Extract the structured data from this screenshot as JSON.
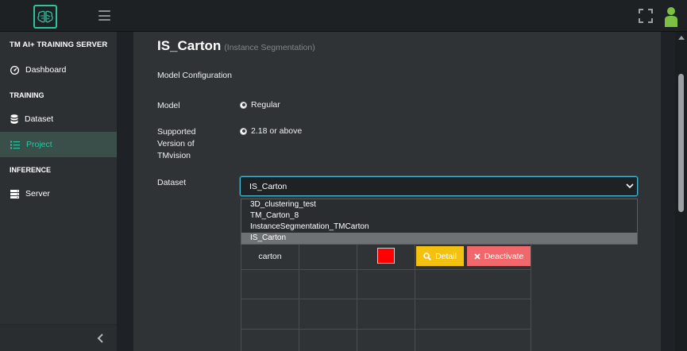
{
  "header": {
    "logo_icon": "brain-icon",
    "menu_icon": "hamburger-icon",
    "fullscreen_icon": "fullscreen-icon",
    "user_icon": "user-icon",
    "accent_color": "#2ec4a0"
  },
  "sidebar": {
    "brand": "TM AI+ TRAINING SERVER",
    "items": [
      {
        "type": "item",
        "label": "Dashboard",
        "icon": "gauge-icon"
      },
      {
        "type": "section",
        "label": "TRAINING"
      },
      {
        "type": "item",
        "label": "Dataset",
        "icon": "database-icon"
      },
      {
        "type": "item",
        "label": "Project",
        "icon": "list-icon",
        "active": true
      },
      {
        "type": "section",
        "label": "INFERENCE"
      },
      {
        "type": "item",
        "label": "Server",
        "icon": "server-icon"
      }
    ],
    "collapse_icon": "chevron-left-icon"
  },
  "page": {
    "title": "IS_Carton",
    "subtitle": "(Instance Segmentation)",
    "section_heading": "Model Configuration"
  },
  "form": {
    "model_label": "Model",
    "model_value": "Regular",
    "version_label": "Supported Version of TMvision",
    "version_value": "2.18 or above",
    "dataset_label": "Dataset",
    "dataset_selected": "IS_Carton",
    "dataset_options": [
      "3D_clustering_test",
      "TM_Carton_8",
      "InstanceSegmentation_TMCarton",
      "IS_Carton"
    ]
  },
  "table": {
    "rows": [
      {
        "name": "carton",
        "color": "#ff0000",
        "detail_label": "Detail",
        "deactivate_label": "Deactivate"
      }
    ]
  },
  "colors": {
    "detail_button": "#f5c110",
    "deactivate_button": "#f0686b",
    "active_sidebar_bg": "#3a4f49"
  }
}
